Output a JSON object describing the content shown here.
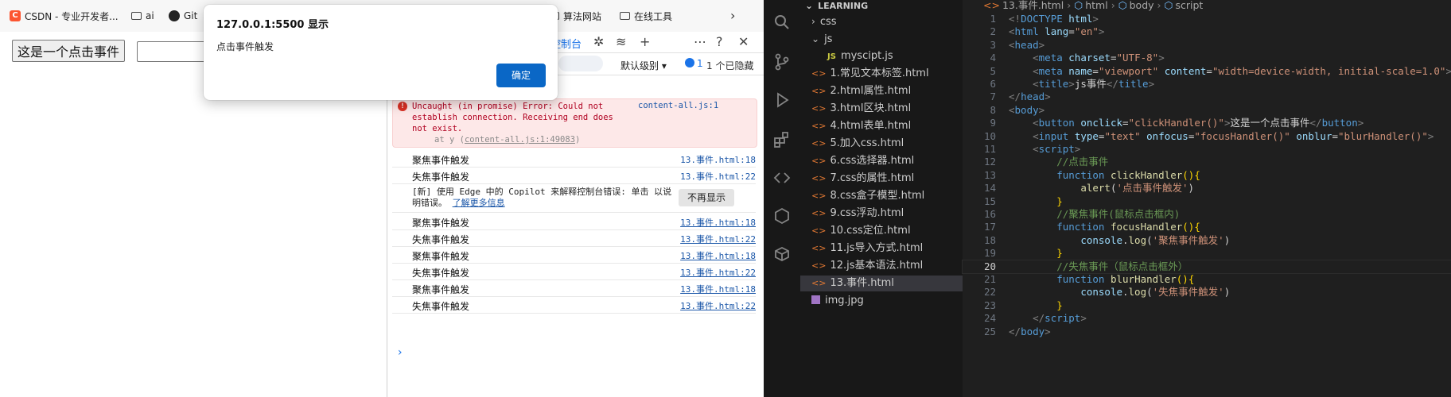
{
  "bookmarks": [
    {
      "label": "CSDN - 专业开发者...",
      "icon": "csdn-icon"
    },
    {
      "label": "ai",
      "icon": "folder-icon"
    },
    {
      "label": "Git",
      "icon": "github-icon"
    },
    {
      "label": "算法网站",
      "icon": "folder-icon"
    },
    {
      "label": "在线工具",
      "icon": "folder-icon"
    }
  ],
  "page": {
    "button_label": "这是一个点击事件"
  },
  "devtools": {
    "tab_label": "控制台",
    "level_label": "默认级别",
    "message_count": "1",
    "hidden_label": "1 个已隐藏",
    "error": {
      "text": "Uncaught (in promise) Error: Could not establish connection. Receiving end does not exist.",
      "at_prefix": "at y (",
      "at_link": "content-all.js:1:49083",
      "at_suffix": ")",
      "source": "content-all.js:1"
    },
    "logs_before": [
      {
        "msg": "聚焦事件触发",
        "src": "13.事件.html:18"
      },
      {
        "msg": "失焦事件触发",
        "src": "13.事件.html:22"
      }
    ],
    "copilot": {
      "text": "[新] 使用 Edge 中的 Copilot 来解释控制台错误: 单击 以说明错误。",
      "link": "了解更多信息",
      "button": "不再显示"
    },
    "logs_after": [
      {
        "msg": "聚焦事件触发",
        "src": "13.事件.html:18"
      },
      {
        "msg": "失焦事件触发",
        "src": "13.事件.html:22"
      },
      {
        "msg": "聚焦事件触发",
        "src": "13.事件.html:18"
      },
      {
        "msg": "失焦事件触发",
        "src": "13.事件.html:22"
      },
      {
        "msg": "聚焦事件触发",
        "src": "13.事件.html:18"
      },
      {
        "msg": "失焦事件触发",
        "src": "13.事件.html:22"
      }
    ],
    "prompt": "›"
  },
  "alert": {
    "title": "127.0.0.1:5500 显示",
    "message": "点击事件触发",
    "ok_label": "确定"
  },
  "explorer": {
    "section": "LEARNING",
    "items": [
      {
        "label": "css",
        "kind": "folder",
        "open": false,
        "depth": 1
      },
      {
        "label": "js",
        "kind": "folder",
        "open": true,
        "depth": 1
      },
      {
        "label": "myscipt.js",
        "kind": "js",
        "depth": 2
      },
      {
        "label": "1.常见文本标签.html",
        "kind": "html",
        "depth": 1
      },
      {
        "label": "2.html属性.html",
        "kind": "html",
        "depth": 1
      },
      {
        "label": "3.html区块.html",
        "kind": "html",
        "depth": 1
      },
      {
        "label": "4.html表单.html",
        "kind": "html",
        "depth": 1
      },
      {
        "label": "5.加入css.html",
        "kind": "html",
        "depth": 1
      },
      {
        "label": "6.css选择器.html",
        "kind": "html",
        "depth": 1
      },
      {
        "label": "7.css的属性.html",
        "kind": "html",
        "depth": 1
      },
      {
        "label": "8.css盒子模型.html",
        "kind": "html",
        "depth": 1
      },
      {
        "label": "9.css浮动.html",
        "kind": "html",
        "depth": 1
      },
      {
        "label": "10.css定位.html",
        "kind": "html",
        "depth": 1
      },
      {
        "label": "11.js导入方式.html",
        "kind": "html",
        "depth": 1
      },
      {
        "label": "12.js基本语法.html",
        "kind": "html",
        "depth": 1
      },
      {
        "label": "13.事件.html",
        "kind": "html",
        "depth": 1,
        "selected": true
      },
      {
        "label": "img.jpg",
        "kind": "img",
        "depth": 1
      }
    ]
  },
  "editor": {
    "breadcrumb": [
      "13.事件.html",
      "html",
      "body",
      "script"
    ],
    "current_line": 20,
    "lines": [
      [
        [
          "p",
          "<!"
        ],
        [
          "t",
          "DOCTYPE"
        ],
        [
          "tx",
          " "
        ],
        [
          "a",
          "html"
        ],
        [
          "p",
          ">"
        ]
      ],
      [
        [
          "p",
          "<"
        ],
        [
          "t",
          "html"
        ],
        [
          "tx",
          " "
        ],
        [
          "a",
          "lang"
        ],
        [
          "tx",
          "="
        ],
        [
          "s",
          "\"en\""
        ],
        [
          "p",
          ">"
        ]
      ],
      [
        [
          "p",
          "<"
        ],
        [
          "t",
          "head"
        ],
        [
          "p",
          ">"
        ]
      ],
      [
        [
          "tx",
          "    "
        ],
        [
          "p",
          "<"
        ],
        [
          "t",
          "meta"
        ],
        [
          "tx",
          " "
        ],
        [
          "a",
          "charset"
        ],
        [
          "tx",
          "="
        ],
        [
          "s",
          "\"UTF-8\""
        ],
        [
          "p",
          ">"
        ]
      ],
      [
        [
          "tx",
          "    "
        ],
        [
          "p",
          "<"
        ],
        [
          "t",
          "meta"
        ],
        [
          "tx",
          " "
        ],
        [
          "a",
          "name"
        ],
        [
          "tx",
          "="
        ],
        [
          "s",
          "\"viewport\""
        ],
        [
          "tx",
          " "
        ],
        [
          "a",
          "content"
        ],
        [
          "tx",
          "="
        ],
        [
          "s",
          "\"width=device-width, initial-scale=1.0\""
        ],
        [
          "p",
          ">"
        ]
      ],
      [
        [
          "tx",
          "    "
        ],
        [
          "p",
          "<"
        ],
        [
          "t",
          "title"
        ],
        [
          "p",
          ">"
        ],
        [
          "tx",
          "js事件"
        ],
        [
          "p",
          "</"
        ],
        [
          "t",
          "title"
        ],
        [
          "p",
          ">"
        ]
      ],
      [
        [
          "p",
          "</"
        ],
        [
          "t",
          "head"
        ],
        [
          "p",
          ">"
        ]
      ],
      [
        [
          "p",
          "<"
        ],
        [
          "t",
          "body"
        ],
        [
          "p",
          ">"
        ]
      ],
      [
        [
          "tx",
          "    "
        ],
        [
          "p",
          "<"
        ],
        [
          "t",
          "button"
        ],
        [
          "tx",
          " "
        ],
        [
          "a",
          "onclick"
        ],
        [
          "tx",
          "="
        ],
        [
          "s",
          "\"clickHandler()\""
        ],
        [
          "p",
          ">"
        ],
        [
          "tx",
          "这是一个点击事件"
        ],
        [
          "p",
          "</"
        ],
        [
          "t",
          "button"
        ],
        [
          "p",
          ">"
        ]
      ],
      [
        [
          "tx",
          "    "
        ],
        [
          "p",
          "<"
        ],
        [
          "t",
          "input"
        ],
        [
          "tx",
          " "
        ],
        [
          "a",
          "type"
        ],
        [
          "tx",
          "="
        ],
        [
          "s",
          "\"text\""
        ],
        [
          "tx",
          " "
        ],
        [
          "a",
          "onfocus"
        ],
        [
          "tx",
          "="
        ],
        [
          "s",
          "\"focusHandler()\""
        ],
        [
          "tx",
          " "
        ],
        [
          "a",
          "onblur"
        ],
        [
          "tx",
          "="
        ],
        [
          "s",
          "\"blurHandler()\""
        ],
        [
          "p",
          ">"
        ]
      ],
      [
        [
          "tx",
          "    "
        ],
        [
          "p",
          "<"
        ],
        [
          "t",
          "script"
        ],
        [
          "p",
          ">"
        ]
      ],
      [
        [
          "tx",
          "        "
        ],
        [
          "c",
          "//点击事件"
        ]
      ],
      [
        [
          "tx",
          "        "
        ],
        [
          "k",
          "function"
        ],
        [
          "tx",
          " "
        ],
        [
          "f",
          "clickHandler"
        ],
        [
          "y",
          "(){"
        ]
      ],
      [
        [
          "tx",
          "            "
        ],
        [
          "f",
          "alert"
        ],
        [
          "tx",
          "("
        ],
        [
          "s",
          "'点击事件触发'"
        ],
        [
          "tx",
          ")"
        ]
      ],
      [
        [
          "tx",
          "        "
        ],
        [
          "y",
          "}"
        ]
      ],
      [
        [
          "tx",
          "        "
        ],
        [
          "c",
          "//聚焦事件(鼠标点击框内)"
        ]
      ],
      [
        [
          "tx",
          "        "
        ],
        [
          "k",
          "function"
        ],
        [
          "tx",
          " "
        ],
        [
          "f",
          "focusHandler"
        ],
        [
          "y",
          "(){"
        ]
      ],
      [
        [
          "tx",
          "            "
        ],
        [
          "a",
          "console"
        ],
        [
          "tx",
          "."
        ],
        [
          "f",
          "log"
        ],
        [
          "tx",
          "("
        ],
        [
          "s",
          "'聚焦事件触发'"
        ],
        [
          "tx",
          ")"
        ]
      ],
      [
        [
          "tx",
          "        "
        ],
        [
          "y",
          "}"
        ]
      ],
      [
        [
          "tx",
          "        "
        ],
        [
          "c",
          "//失焦事件（鼠标点击框外）"
        ]
      ],
      [
        [
          "tx",
          "        "
        ],
        [
          "k",
          "function"
        ],
        [
          "tx",
          " "
        ],
        [
          "f",
          "blurHandler"
        ],
        [
          "y",
          "(){"
        ]
      ],
      [
        [
          "tx",
          "            "
        ],
        [
          "a",
          "console"
        ],
        [
          "tx",
          "."
        ],
        [
          "f",
          "log"
        ],
        [
          "tx",
          "("
        ],
        [
          "s",
          "'失焦事件触发'"
        ],
        [
          "tx",
          ")"
        ]
      ],
      [
        [
          "tx",
          "        "
        ],
        [
          "y",
          "}"
        ]
      ],
      [
        [
          "tx",
          "    "
        ],
        [
          "p",
          "</"
        ],
        [
          "t",
          "script"
        ],
        [
          "p",
          ">"
        ]
      ],
      [
        [
          "p",
          "</"
        ],
        [
          "t",
          "body"
        ],
        [
          "p",
          ">"
        ]
      ]
    ]
  },
  "colors": {
    "alert_button": "#0a67c6",
    "devtools_link": "#1a56a8",
    "error_bg": "#fde8e8",
    "vscode_bg": "#1f1f1f"
  }
}
